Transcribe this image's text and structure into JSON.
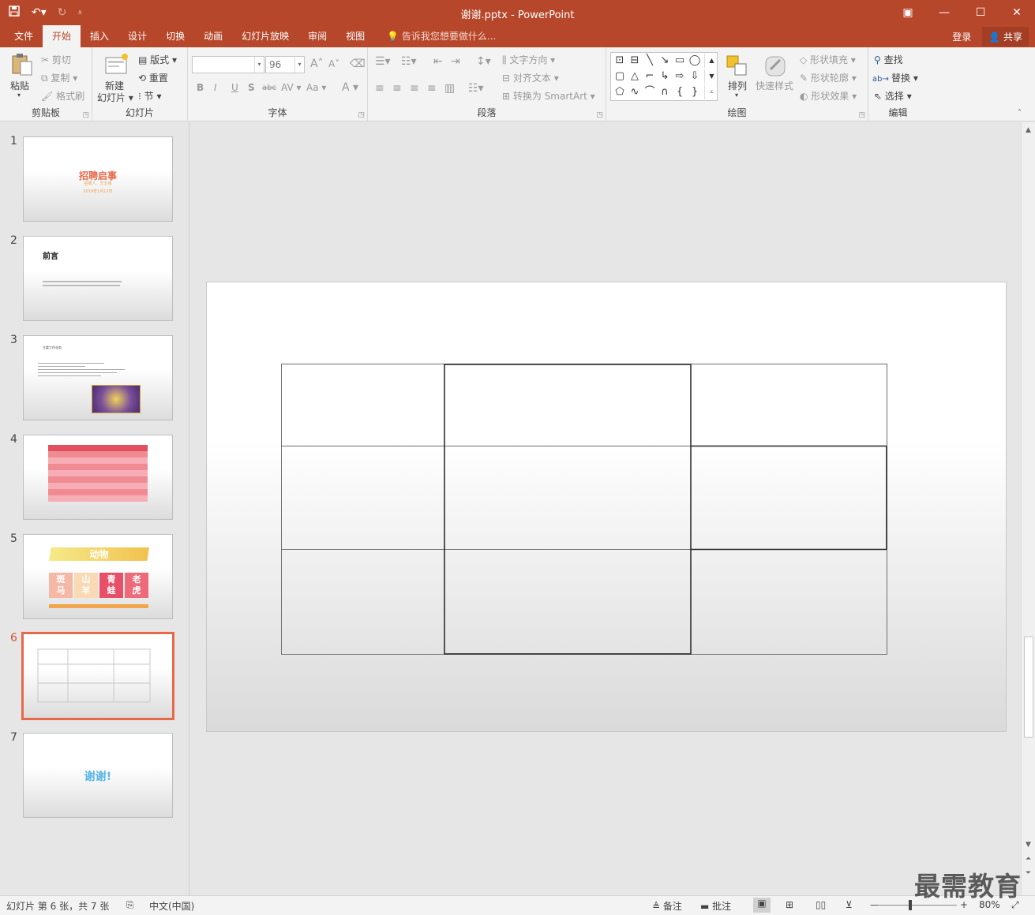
{
  "window": {
    "title": "谢谢.pptx - PowerPoint",
    "qat_items": [
      "save-icon",
      "undo-icon",
      "redo-icon",
      "customize-icon"
    ],
    "controls": [
      "ribbon-display-icon",
      "minimize-icon",
      "maximize-icon",
      "close-icon"
    ]
  },
  "tabs": [
    "文件",
    "开始",
    "插入",
    "设计",
    "切换",
    "动画",
    "幻灯片放映",
    "审阅",
    "视图"
  ],
  "active_tab": "开始",
  "tell_me": "告诉我您想要做什么...",
  "account": {
    "signin": "登录",
    "share": "共享"
  },
  "ribbon": {
    "clipboard": {
      "label": "剪贴板",
      "paste": "粘贴",
      "cut": "剪切",
      "copy": "复制",
      "format_painter": "格式刷"
    },
    "slides": {
      "label": "幻灯片",
      "new_slide_line1": "新建",
      "new_slide_line2": "幻灯片",
      "layout": "版式",
      "reset": "重置",
      "section": "节"
    },
    "font": {
      "label": "字体",
      "font_name": "",
      "font_size": "96"
    },
    "paragraph": {
      "label": "段落",
      "text_direction": "文字方向",
      "align_text": "对齐文本",
      "smartart": "转换为 SmartArt"
    },
    "drawing": {
      "label": "绘图",
      "arrange": "排列",
      "quick_styles": "快速样式",
      "shape_fill": "形状填充",
      "shape_outline": "形状轮廓",
      "shape_effects": "形状效果"
    },
    "editing": {
      "label": "编辑",
      "find": "查找",
      "replace": "替换",
      "select": "选择"
    }
  },
  "thumbnails": {
    "numbers": [
      "1",
      "2",
      "3",
      "4",
      "5",
      "6",
      "7"
    ],
    "slide1": {
      "title": "招聘启事",
      "line1": "招聘人：王五强",
      "line2": "2019年1月12日"
    },
    "slide2": {
      "title": "前言"
    },
    "slide3": {
      "title": "主要工作业务"
    },
    "slide5": {
      "banner": "动物",
      "cards": [
        "斑马",
        "山羊",
        "青蛙",
        "老虎"
      ]
    },
    "slide7": {
      "title": "谢谢!"
    }
  },
  "current_slide": 6,
  "status": {
    "slide_info": "幻灯片 第 6 张，共 7 张",
    "language": "中文(中国)",
    "notes": "备注",
    "comments": "批注",
    "zoom": "80%"
  },
  "watermark": "最需教育",
  "colors": {
    "accent": "#b7472a",
    "selected_thumb": "#e8694a"
  }
}
